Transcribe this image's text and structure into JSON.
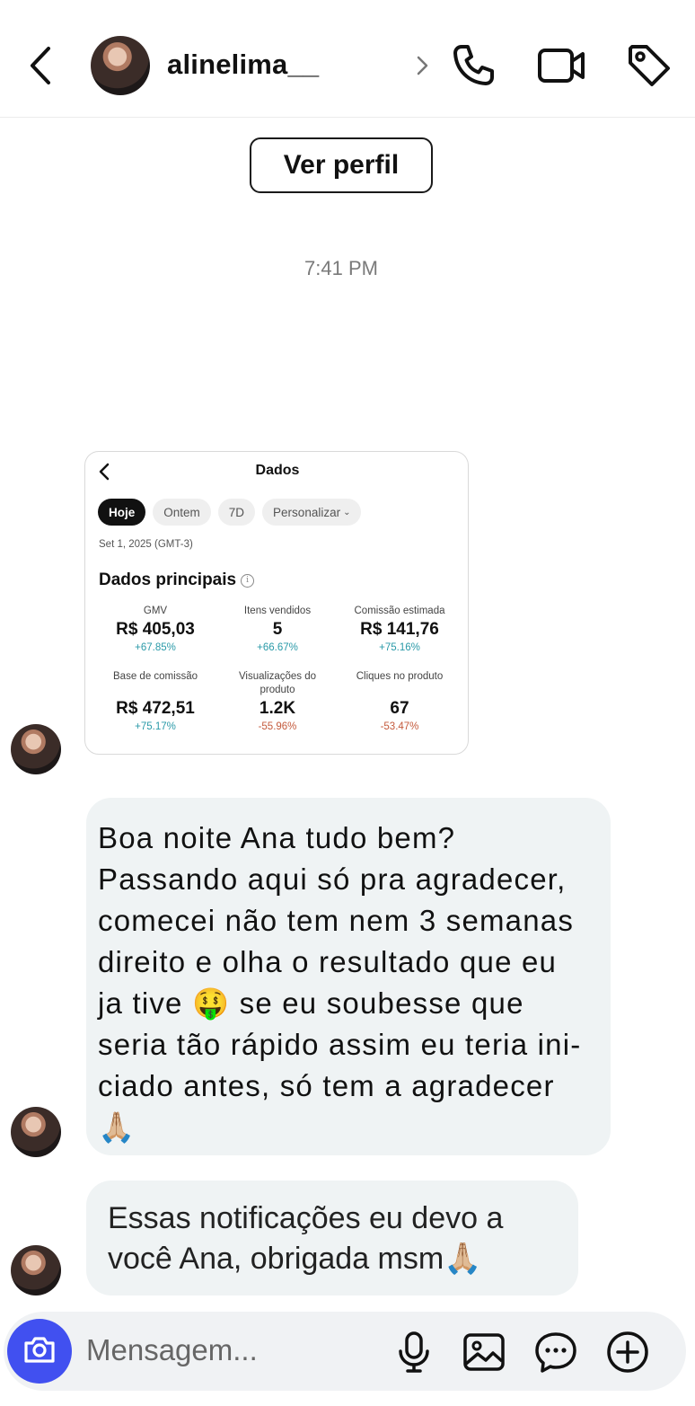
{
  "header": {
    "username": "alinelima__",
    "icons": [
      "back-arrow-icon",
      "chevron-right-icon",
      "phone-icon",
      "video-icon",
      "tag-icon"
    ]
  },
  "profile_button": "Ver perfil",
  "timestamp": "7:41 PM",
  "shared_screenshot": {
    "title": "Dados",
    "chips": [
      "Hoje",
      "Ontem",
      "7D",
      "Personalizar"
    ],
    "active_chip": "Hoje",
    "date": "Set 1, 2025 (GMT-3)",
    "section_title": "Dados principais",
    "metrics": [
      {
        "label": "GMV",
        "value": "R$ 405,03",
        "delta": "+67.85%",
        "trend": "up"
      },
      {
        "label": "Itens vendidos",
        "value": "5",
        "delta": "+66.67%",
        "trend": "up"
      },
      {
        "label": "Comissão estimada",
        "value": "R$ 141,76",
        "delta": "+75.16%",
        "trend": "up"
      },
      {
        "label": "Base de comissão",
        "value": "R$ 472,51",
        "delta": "+75.17%",
        "trend": "up"
      },
      {
        "label": "Visualizações do produto",
        "value": "1.2K",
        "delta": "-55.96%",
        "trend": "down"
      },
      {
        "label": "Cliques no produto",
        "value": "67",
        "delta": "-53.47%",
        "trend": "down"
      }
    ],
    "colors": {
      "positive": "#2a9aa8",
      "negative": "#c45a3c"
    }
  },
  "messages": [
    {
      "text": "Boa noite Ana tudo bem?\nPassando aqui só pra agradecer,\ncomecei não tem nem 3 semanas\ndireito e olha o resultado que eu\nja tive 🤑 se eu soubesse que\nseria tão rápido assim eu teria ini-\nciado antes, só tem a agradecer\n🙏🏼"
    },
    {
      "text": "Essas notificações eu devo a\nvocê Ana, obrigada msm🙏🏼"
    }
  ],
  "composer": {
    "placeholder": "Mensagem...",
    "accent": "#4150f0",
    "icons": [
      "camera-icon",
      "microphone-icon",
      "image-icon",
      "sticker-icon",
      "plus-icon"
    ]
  }
}
